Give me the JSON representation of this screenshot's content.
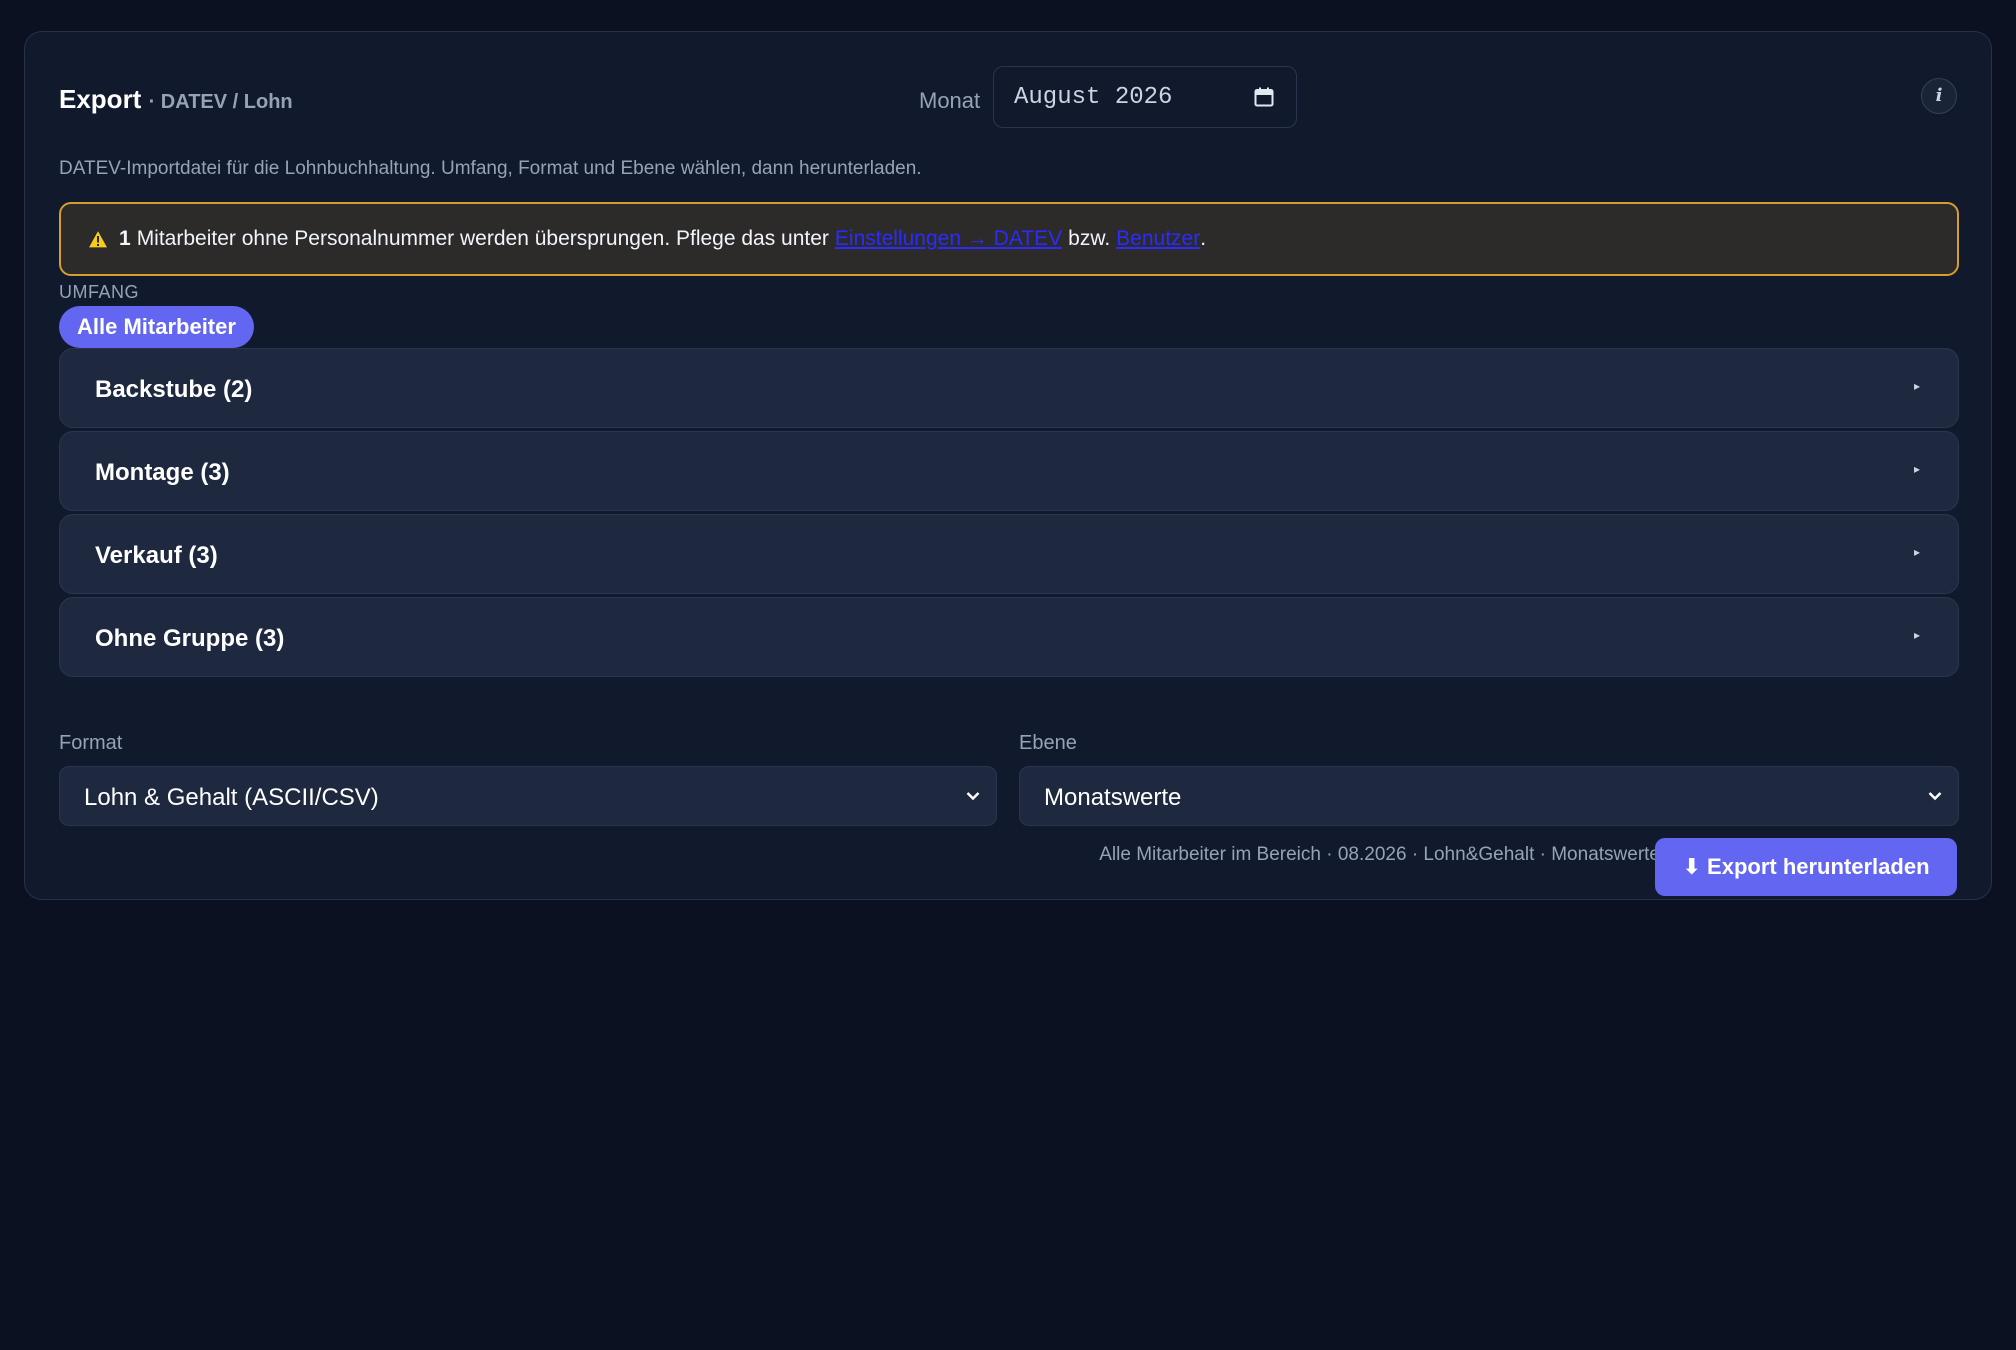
{
  "header": {
    "title": "Export",
    "subtitle": "· DATEV / Lohn",
    "month_label": "Monat",
    "month_value": "August 2026",
    "info_label": "i"
  },
  "description": "DATEV-Importdatei für die Lohnbuchhaltung. Umfang, Format und Ebene wählen, dann herunterladen.",
  "warning": {
    "count": "1",
    "text": "Mitarbeiter ohne Personalnummer werden übersprungen. Pflege das unter",
    "link1": "Einstellungen → DATEV",
    "mid": "bzw.",
    "link2": "Benutzer",
    "end": "."
  },
  "scope": {
    "label": "UMFANG",
    "pill": "Alle Mitarbeiter",
    "groups": [
      {
        "label": "Backstube (2)"
      },
      {
        "label": "Montage (3)"
      },
      {
        "label": "Verkauf (3)"
      },
      {
        "label": "Ohne Gruppe (3)"
      }
    ],
    "caret": "▸"
  },
  "format": {
    "label": "Format",
    "value": "Lohn & Gehalt (ASCII/CSV)"
  },
  "level": {
    "label": "Ebene",
    "value": "Monatswerte"
  },
  "summary": "Alle Mitarbeiter im Bereich · 08.2026 · Lohn&Gehalt · Monatswerte",
  "export_button": "⬇ Export herunterladen",
  "colors": {
    "background": "#0b1120",
    "card": "#111a2c",
    "accent": "#6366f1",
    "warning_border": "#d69e2e"
  }
}
